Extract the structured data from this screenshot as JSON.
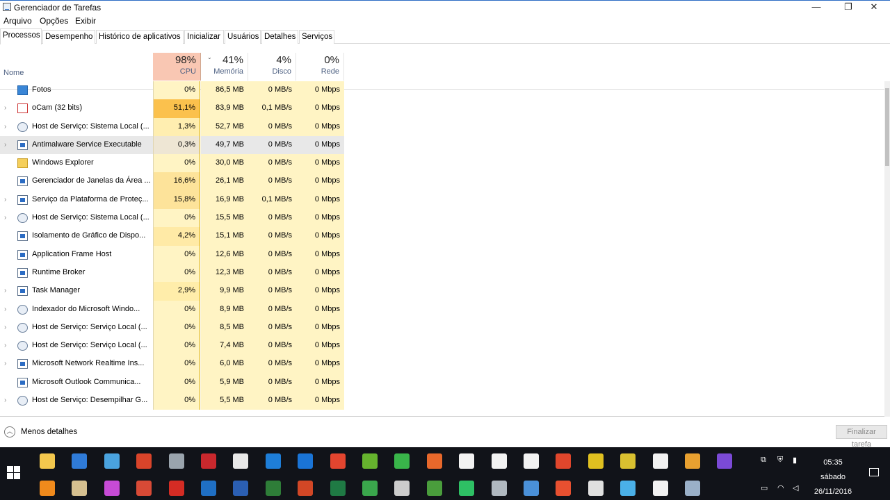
{
  "window": {
    "title": "Gerenciador de Tarefas",
    "min": "—",
    "restore": "❐",
    "close": "✕"
  },
  "menu": [
    "Arquivo",
    "Opções",
    "Exibir"
  ],
  "tabs": [
    "Processos",
    "Desempenho",
    "Histórico de aplicativos",
    "Inicializar",
    "Usuários",
    "Detalhes",
    "Serviços"
  ],
  "header": {
    "name_label": "Nome",
    "cpu": {
      "pct": "98%",
      "label": "CPU"
    },
    "memory": {
      "pct": "41%",
      "label": "Memória"
    },
    "disk": {
      "pct": "4%",
      "label": "Disco"
    },
    "network": {
      "pct": "0%",
      "label": "Rede"
    }
  },
  "processes": [
    {
      "name": "Fotos",
      "cpu": "0%",
      "mem": "86,5 MB",
      "disk": "0 MB/s",
      "net": "0 Mbps",
      "expandable": false,
      "icon": "photos-icon",
      "cpu_bg": "#fff4c4"
    },
    {
      "name": "oCam (32 bits)",
      "cpu": "51,1%",
      "mem": "83,9 MB",
      "disk": "0,1 MB/s",
      "net": "0 Mbps",
      "expandable": true,
      "icon": "ocam-icon",
      "cpu_bg": "#fbc14d"
    },
    {
      "name": "Host de Serviço: Sistema Local (...",
      "cpu": "1,3%",
      "mem": "52,7 MB",
      "disk": "0 MB/s",
      "net": "0 Mbps",
      "expandable": true,
      "icon": "service-host-icon",
      "cpu_bg": "#ffeeb0"
    },
    {
      "name": "Antimalware Service Executable",
      "cpu": "0,3%",
      "mem": "49,7 MB",
      "disk": "0 MB/s",
      "net": "0 Mbps",
      "expandable": true,
      "icon": "app-window-icon",
      "cpu_bg": "#eee6d4"
    },
    {
      "name": "Windows Explorer",
      "cpu": "0%",
      "mem": "30,0 MB",
      "disk": "0 MB/s",
      "net": "0 Mbps",
      "expandable": false,
      "icon": "folder-icon",
      "cpu_bg": "#fff4c4"
    },
    {
      "name": "Gerenciador de Janelas da Área ...",
      "cpu": "16,6%",
      "mem": "26,1 MB",
      "disk": "0 MB/s",
      "net": "0 Mbps",
      "expandable": false,
      "icon": "app-window-icon",
      "cpu_bg": "#fde39a"
    },
    {
      "name": "Serviço da Plataforma de Proteç...",
      "cpu": "15,8%",
      "mem": "16,9 MB",
      "disk": "0,1 MB/s",
      "net": "0 Mbps",
      "expandable": true,
      "icon": "app-window-icon",
      "cpu_bg": "#fde39a"
    },
    {
      "name": "Host de Serviço: Sistema Local (...",
      "cpu": "0%",
      "mem": "15,5 MB",
      "disk": "0 MB/s",
      "net": "0 Mbps",
      "expandable": true,
      "icon": "service-host-icon",
      "cpu_bg": "#fff4c4"
    },
    {
      "name": "Isolamento de Gráfico de Dispo...",
      "cpu": "4,2%",
      "mem": "15,1 MB",
      "disk": "0 MB/s",
      "net": "0 Mbps",
      "expandable": false,
      "icon": "app-window-icon",
      "cpu_bg": "#ffeaa6"
    },
    {
      "name": "Application Frame Host",
      "cpu": "0%",
      "mem": "12,6 MB",
      "disk": "0 MB/s",
      "net": "0 Mbps",
      "expandable": false,
      "icon": "app-window-icon",
      "cpu_bg": "#fff4c4"
    },
    {
      "name": "Runtime Broker",
      "cpu": "0%",
      "mem": "12,3 MB",
      "disk": "0 MB/s",
      "net": "0 Mbps",
      "expandable": false,
      "icon": "app-window-icon",
      "cpu_bg": "#fff4c4"
    },
    {
      "name": "Task Manager",
      "cpu": "2,9%",
      "mem": "9,9 MB",
      "disk": "0 MB/s",
      "net": "0 Mbps",
      "expandable": true,
      "icon": "task-manager-icon",
      "cpu_bg": "#ffedaa"
    },
    {
      "name": "Indexador do Microsoft Windo...",
      "cpu": "0%",
      "mem": "8,9 MB",
      "disk": "0 MB/s",
      "net": "0 Mbps",
      "expandable": true,
      "icon": "indexer-icon",
      "cpu_bg": "#fff4c4"
    },
    {
      "name": "Host de Serviço: Serviço Local (...",
      "cpu": "0%",
      "mem": "8,5 MB",
      "disk": "0 MB/s",
      "net": "0 Mbps",
      "expandable": true,
      "icon": "service-host-icon",
      "cpu_bg": "#fff4c4"
    },
    {
      "name": "Host de Serviço: Serviço Local (...",
      "cpu": "0%",
      "mem": "7,4 MB",
      "disk": "0 MB/s",
      "net": "0 Mbps",
      "expandable": true,
      "icon": "service-host-icon",
      "cpu_bg": "#fff4c4"
    },
    {
      "name": "Microsoft Network Realtime Ins...",
      "cpu": "0%",
      "mem": "6,0 MB",
      "disk": "0 MB/s",
      "net": "0 Mbps",
      "expandable": true,
      "icon": "app-window-icon",
      "cpu_bg": "#fff4c4"
    },
    {
      "name": "Microsoft Outlook Communica...",
      "cpu": "0%",
      "mem": "5,9 MB",
      "disk": "0 MB/s",
      "net": "0 Mbps",
      "expandable": false,
      "icon": "app-window-icon",
      "cpu_bg": "#fff4c4"
    },
    {
      "name": "Host de Serviço: Desempilhar G...",
      "cpu": "0%",
      "mem": "5,5 MB",
      "disk": "0 MB/s",
      "net": "0 Mbps",
      "expandable": true,
      "icon": "service-host-icon",
      "cpu_bg": "#fff4c4"
    }
  ],
  "footer": {
    "less_details": "Menos detalhes",
    "end_task": "Finalizar tarefa"
  },
  "taskbar": {
    "time": "05:35",
    "day": "sábado",
    "date": "26/11/2016",
    "pinned_row1": [
      {
        "name": "file-explorer-icon",
        "color": "#f3c74d"
      },
      {
        "name": "defender-icon",
        "color": "#2f7bd8"
      },
      {
        "name": "control-panel-icon",
        "color": "#4aa3df"
      },
      {
        "name": "ccleaner-icon",
        "color": "#d9442a"
      },
      {
        "name": "remote-desktop-icon",
        "color": "#9aa4ad"
      },
      {
        "name": "filezilla-icon",
        "color": "#c9282d"
      },
      {
        "name": "notepad-icon",
        "color": "#e8e8e8"
      },
      {
        "name": "ie-icon",
        "color": "#1e7ed8"
      },
      {
        "name": "edge-icon",
        "color": "#1a74d6"
      },
      {
        "name": "chrome-icon",
        "color": "#e3452f"
      },
      {
        "name": "utorrent-icon",
        "color": "#66b32e"
      },
      {
        "name": "maps-icon",
        "color": "#39b54a"
      },
      {
        "name": "mega-icon",
        "color": "#e8682b"
      },
      {
        "name": "mail-icon",
        "color": "#f2f2f2"
      },
      {
        "name": "calculator-icon",
        "color": "#f2f2f2"
      },
      {
        "name": "store-icon",
        "color": "#f2f2f2"
      },
      {
        "name": "media-icon",
        "color": "#e0462c"
      },
      {
        "name": "disc-icon",
        "color": "#e0c020"
      },
      {
        "name": "dvd-icon",
        "color": "#d9c030"
      },
      {
        "name": "groove-icon",
        "color": "#f2f2f2"
      },
      {
        "name": "video-icon",
        "color": "#e8a030"
      },
      {
        "name": "visual-studio-icon",
        "color": "#7b4ad6"
      }
    ],
    "pinned_row2": [
      {
        "name": "vlc-icon",
        "color": "#f08a1c"
      },
      {
        "name": "paint-icon",
        "color": "#d6c090"
      },
      {
        "name": "picasa-icon",
        "color": "#c74bd6"
      },
      {
        "name": "sync-icon",
        "color": "#d84a36"
      },
      {
        "name": "acrobat-icon",
        "color": "#d42c24"
      },
      {
        "name": "outlook-icon",
        "color": "#1f6fc4"
      },
      {
        "name": "word-icon",
        "color": "#2b5fb3"
      },
      {
        "name": "project-icon",
        "color": "#2e7d38"
      },
      {
        "name": "powerpoint-icon",
        "color": "#d24726"
      },
      {
        "name": "excel-icon",
        "color": "#1f7a44"
      },
      {
        "name": "camtasia-icon",
        "color": "#3aa64c"
      },
      {
        "name": "cable-icon",
        "color": "#cccccc"
      },
      {
        "name": "xbox-icon",
        "color": "#4a9d3c"
      },
      {
        "name": "whatsapp-icon",
        "color": "#2ec064"
      },
      {
        "name": "skate-icon",
        "color": "#b0b8c0"
      },
      {
        "name": "gadget-icon",
        "color": "#4a90d8"
      },
      {
        "name": "box-icon",
        "color": "#e85030"
      },
      {
        "name": "robot-icon",
        "color": "#e0e0e0"
      },
      {
        "name": "monitor-icon",
        "color": "#4ab0e8"
      },
      {
        "name": "photos-taskbar-icon",
        "color": "#f2f2f2"
      },
      {
        "name": "task-manager-taskbar-icon",
        "color": "#9ab0c8"
      }
    ]
  }
}
